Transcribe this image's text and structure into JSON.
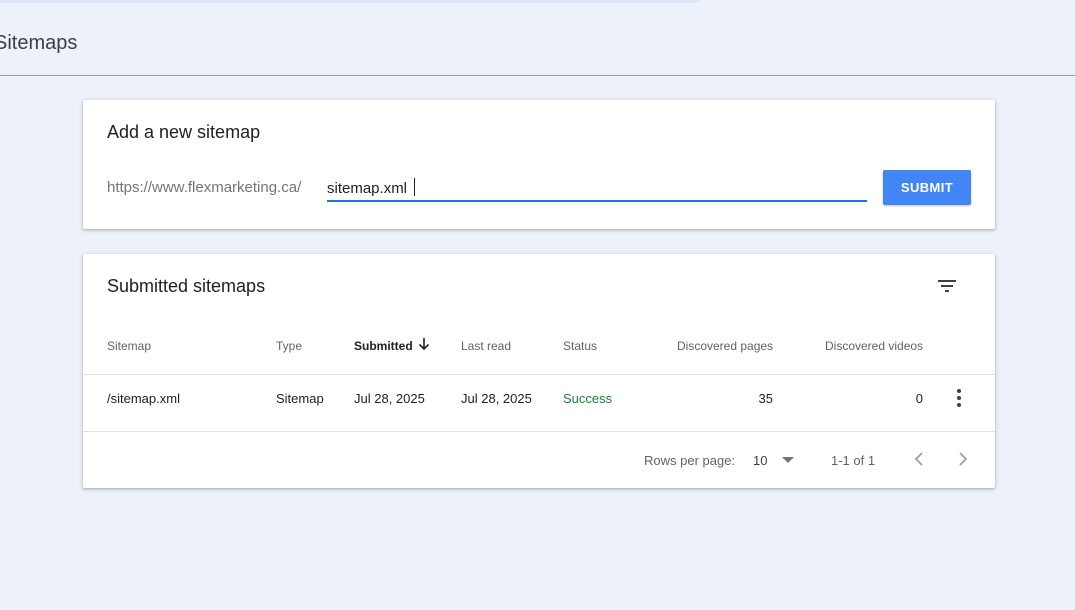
{
  "page": {
    "title": "Sitemaps"
  },
  "add_sitemap": {
    "title": "Add a new sitemap",
    "url_prefix": "https://www.flexmarketing.ca/",
    "input_value": "sitemap.xml",
    "submit_label": "SUBMIT"
  },
  "submitted": {
    "title": "Submitted sitemaps",
    "columns": {
      "sitemap": "Sitemap",
      "type": "Type",
      "submitted": "Submitted",
      "last_read": "Last read",
      "status": "Status",
      "discovered_pages": "Discovered pages",
      "discovered_videos": "Discovered videos"
    },
    "rows": [
      {
        "sitemap": "/sitemap.xml",
        "type": "Sitemap",
        "submitted": "Jul 28, 2025",
        "last_read": "Jul 28, 2025",
        "status": "Success",
        "discovered_pages": "35",
        "discovered_videos": "0"
      }
    ],
    "pagination": {
      "rows_per_page_label": "Rows per page:",
      "rows_per_page_value": "10",
      "range": "1-1 of 1"
    }
  },
  "colors": {
    "accent": "#1a73e8",
    "button": "#4285f4",
    "success": "#188038",
    "background": "#edf1f9"
  },
  "icons": {
    "filter": "filter-icon",
    "sort": "arrow-down-icon",
    "more": "more-vert-icon",
    "dropdown": "caret-down-icon",
    "prev": "chevron-left-icon",
    "next": "chevron-right-icon"
  }
}
